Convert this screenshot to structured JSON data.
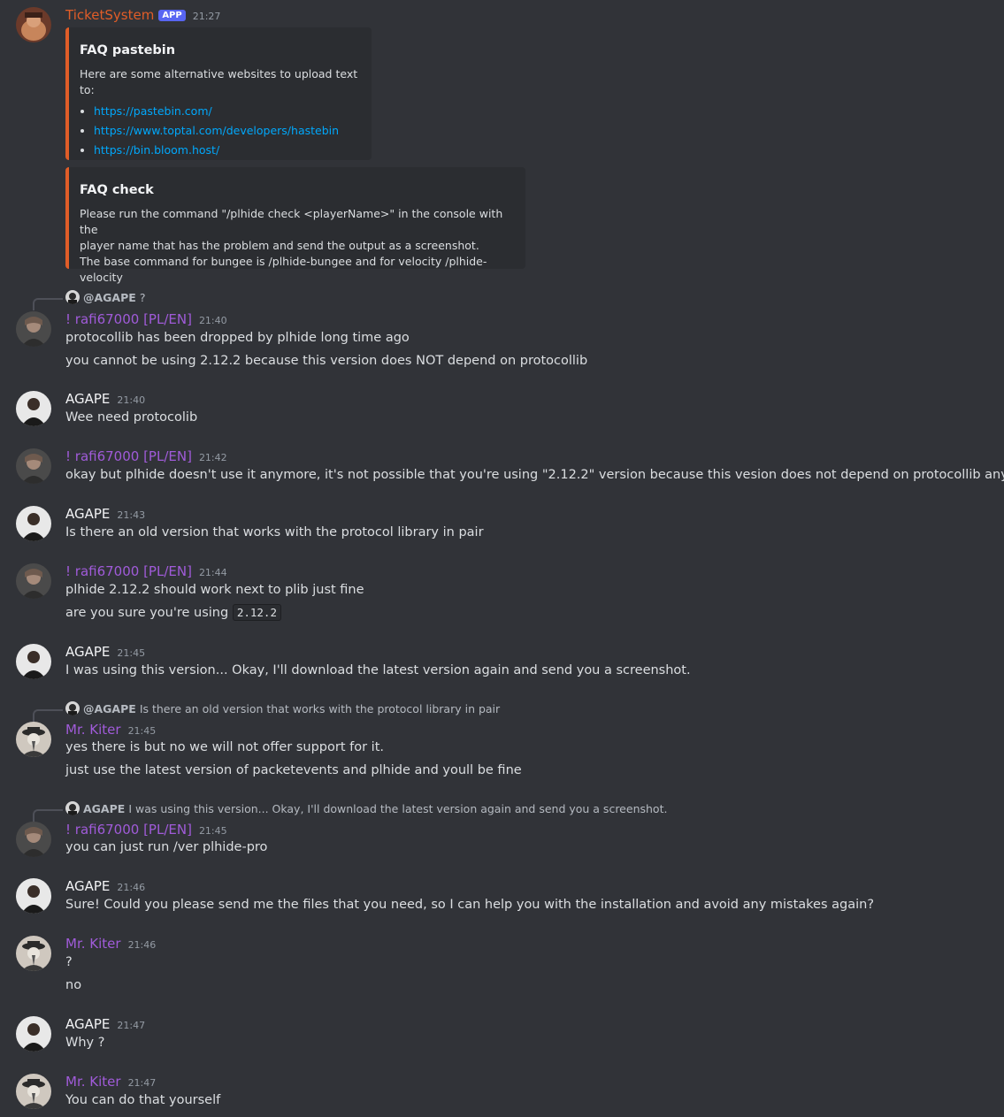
{
  "colors": {
    "background": "#313338",
    "embed_bg": "#2b2d31",
    "embed_accent": "#e05d28",
    "link": "#00a8fc",
    "ticket_name": "#e05d28",
    "rafi_name": "#a05bd9",
    "kiter_name": "#a05bd9",
    "agape_name": "#f2f3f5",
    "app_badge": "#5865f2"
  },
  "bot": {
    "name": "TicketSystem",
    "badge": "APP",
    "time": "21:27",
    "embeds": [
      {
        "title": "FAQ pastebin",
        "intro": "Here are some alternative websites to upload text to:",
        "links": [
          "https://pastebin.com/",
          "https://www.toptal.com/developers/hastebin",
          "https://bin.bloom.host/"
        ]
      },
      {
        "title": "FAQ check",
        "lines": [
          "Please run the command \"/plhide check <playerName>\" in the console with the",
          "player name that has the problem and send the output as a screenshot.",
          "The base command for bungee is /plhide-bungee and for velocity /plhide-velocity"
        ]
      }
    ]
  },
  "messages": [
    {
      "reply": {
        "name": "@AGAPE",
        "text": "?"
      },
      "author": "! rafi67000 [PL/EN]",
      "time": "21:40",
      "lines": [
        "protocollib has been dropped by plhide long time ago",
        "you cannot be using 2.12.2 because this version does NOT depend on protocollib"
      ]
    },
    {
      "author": "AGAPE",
      "time": "21:40",
      "lines": [
        "Wee need protocolib"
      ]
    },
    {
      "author": "! rafi67000 [PL/EN]",
      "time": "21:42",
      "lines": [
        "okay but plhide doesn't use it anymore, it's not possible that you're using \"2.12.2\" version because this vesion does not depend on protocollib anymore"
      ]
    },
    {
      "author": "AGAPE",
      "time": "21:43",
      "lines": [
        "Is there an old version that works with the protocol library in pair"
      ]
    },
    {
      "author": "! rafi67000 [PL/EN]",
      "time": "21:44",
      "lines": [
        "plhide 2.12.2 should work next to plib just fine",
        "are you sure you're using"
      ],
      "code": "2.12.2"
    },
    {
      "author": "AGAPE",
      "time": "21:45",
      "lines": [
        "I was using this version... Okay, I'll download the latest version again and send you a screenshot."
      ]
    },
    {
      "reply": {
        "name": "@AGAPE",
        "text": "Is there an old version that works with the protocol library in pair"
      },
      "author": "Mr. Kiter",
      "time": "21:45",
      "lines": [
        "yes there is but no we will not offer support for it.",
        "just use the latest version of packetevents and plhide and youll be fine"
      ]
    },
    {
      "reply": {
        "name": "AGAPE",
        "text": "I was using this version... Okay, I'll download the latest version again and send you a screenshot."
      },
      "author": "! rafi67000 [PL/EN]",
      "time": "21:45",
      "lines": [
        "you can just run /ver plhide-pro"
      ]
    },
    {
      "author": "AGAPE",
      "time": "21:46",
      "lines": [
        "Sure! Could you please send me the files that you need, so I can help you with the installation and avoid any mistakes again?"
      ]
    },
    {
      "author": "Mr. Kiter",
      "time": "21:46",
      "lines": [
        "?",
        "no"
      ]
    },
    {
      "author": "AGAPE",
      "time": "21:47",
      "lines": [
        "Why ?"
      ]
    },
    {
      "author": "Mr. Kiter",
      "time": "21:47",
      "lines": [
        "You can do that yourself"
      ]
    }
  ]
}
